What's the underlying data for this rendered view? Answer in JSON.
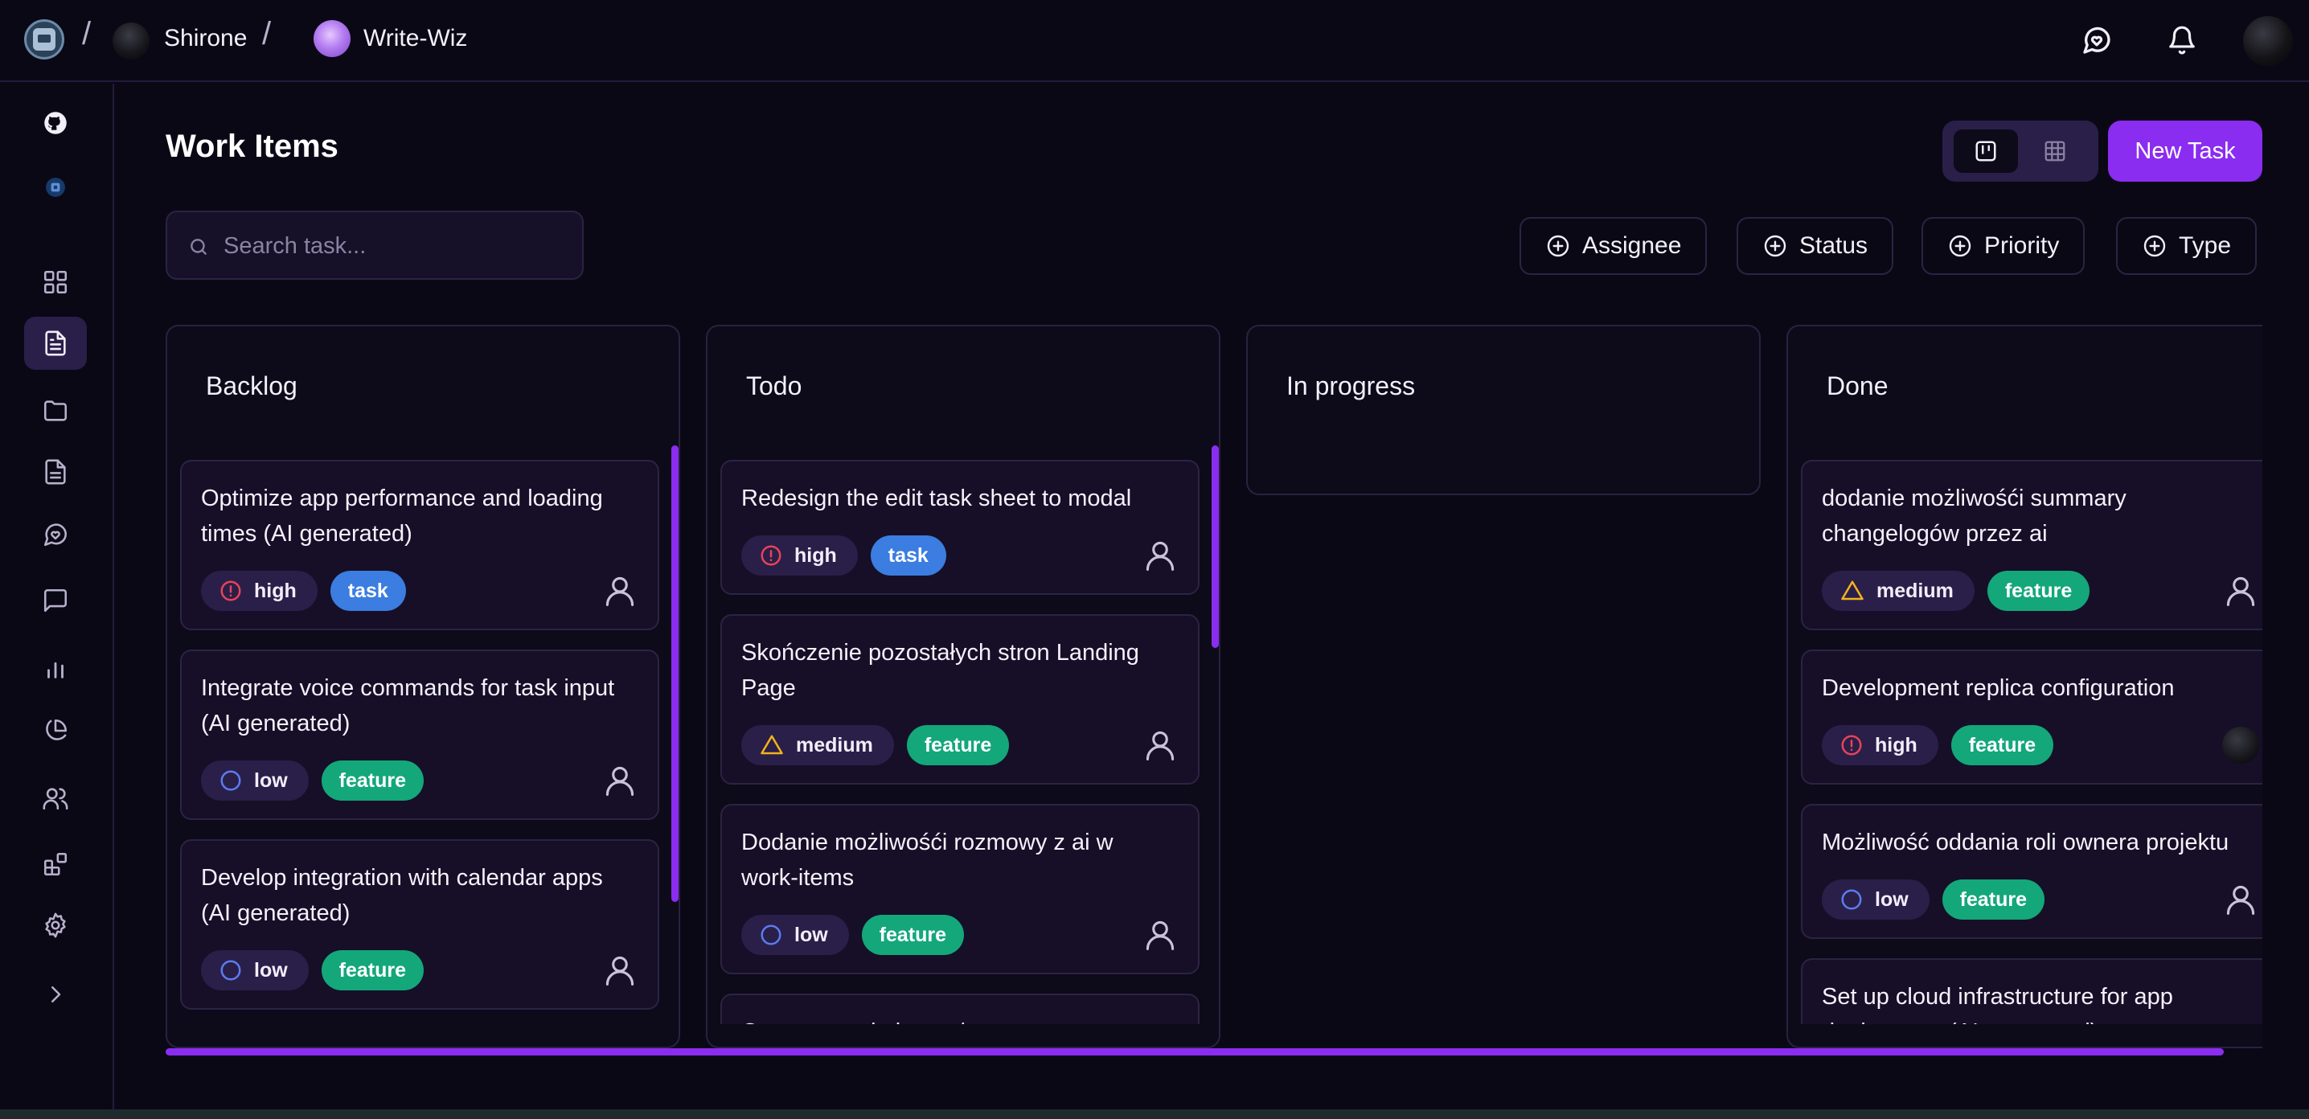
{
  "breadcrumb": {
    "user": "Shirone",
    "project": "Write-Wiz",
    "separator": "/"
  },
  "topbar_icons": [
    "chat-heart-icon",
    "bell-icon"
  ],
  "sidebar": {
    "items": [
      {
        "name": "github-icon",
        "active": false
      },
      {
        "name": "project-icon",
        "active": false
      },
      {
        "name": "dashboard-icon",
        "active": false
      },
      {
        "name": "work-items-icon",
        "active": true
      },
      {
        "name": "folder-icon",
        "active": false
      },
      {
        "name": "document-icon",
        "active": false
      },
      {
        "name": "chat-ai-icon",
        "active": false
      },
      {
        "name": "message-icon",
        "active": false
      },
      {
        "name": "bar-chart-icon",
        "active": false
      },
      {
        "name": "pie-chart-icon",
        "active": false
      },
      {
        "name": "users-icon",
        "active": false
      },
      {
        "name": "integrations-icon",
        "active": false
      },
      {
        "name": "settings-icon",
        "active": false
      },
      {
        "name": "expand-icon",
        "active": false
      }
    ]
  },
  "page": {
    "title": "Work Items",
    "new_task_label": "New Task",
    "view_modes": [
      {
        "name": "kanban-view-icon",
        "active": true
      },
      {
        "name": "table-view-icon",
        "active": false
      }
    ]
  },
  "search": {
    "placeholder": "Search task...",
    "value": ""
  },
  "filters": [
    {
      "label": "Assignee"
    },
    {
      "label": "Status"
    },
    {
      "label": "Priority"
    },
    {
      "label": "Type"
    }
  ],
  "columns": [
    {
      "title": "Backlog",
      "cards": [
        {
          "title": "Optimize app performance and loading times (AI generated)",
          "priority": "high",
          "type": "task",
          "assignee": "placeholder"
        },
        {
          "title": "Integrate voice commands for task input (AI generated)",
          "priority": "low",
          "type": "feature",
          "assignee": "placeholder"
        },
        {
          "title": "Develop integration with calendar apps (AI generated)",
          "priority": "low",
          "type": "feature",
          "assignee": "placeholder"
        }
      ]
    },
    {
      "title": "Todo",
      "cards": [
        {
          "title": "Redesign the edit task sheet to modal",
          "priority": "high",
          "type": "task",
          "assignee": "placeholder"
        },
        {
          "title": "Skończenie pozostałych stron Landing Page",
          "priority": "medium",
          "type": "feature",
          "assignee": "placeholder"
        },
        {
          "title": "Dodanie możliwośći rozmowy z ai w work-items",
          "priority": "low",
          "type": "feature",
          "assignee": "placeholder"
        },
        {
          "title": "Customowe kolumny/",
          "priority": "",
          "type": "",
          "assignee": "placeholder"
        }
      ]
    },
    {
      "title": "In progress",
      "cards": []
    },
    {
      "title": "Done",
      "cards": [
        {
          "title": "dodanie możliwośći summary changelogów przez ai",
          "priority": "medium",
          "type": "feature",
          "assignee": "placeholder"
        },
        {
          "title": "Development replica configuration",
          "priority": "high",
          "type": "feature",
          "assignee": "photo"
        },
        {
          "title": "Możliwość oddania roli ownera projektu",
          "priority": "low",
          "type": "feature",
          "assignee": "placeholder"
        },
        {
          "title": "Set up cloud infrastructure for app deployment (AI generated)",
          "priority": "",
          "type": "",
          "assignee": "placeholder"
        }
      ]
    }
  ],
  "colors": {
    "background": "#0b0816",
    "accent": "#8a2df0",
    "priority_high": "#e8435a",
    "priority_medium": "#f2b31b",
    "priority_low": "#5b7cf0",
    "type_task": "#3b7de0",
    "type_feature": "#14a77a"
  }
}
